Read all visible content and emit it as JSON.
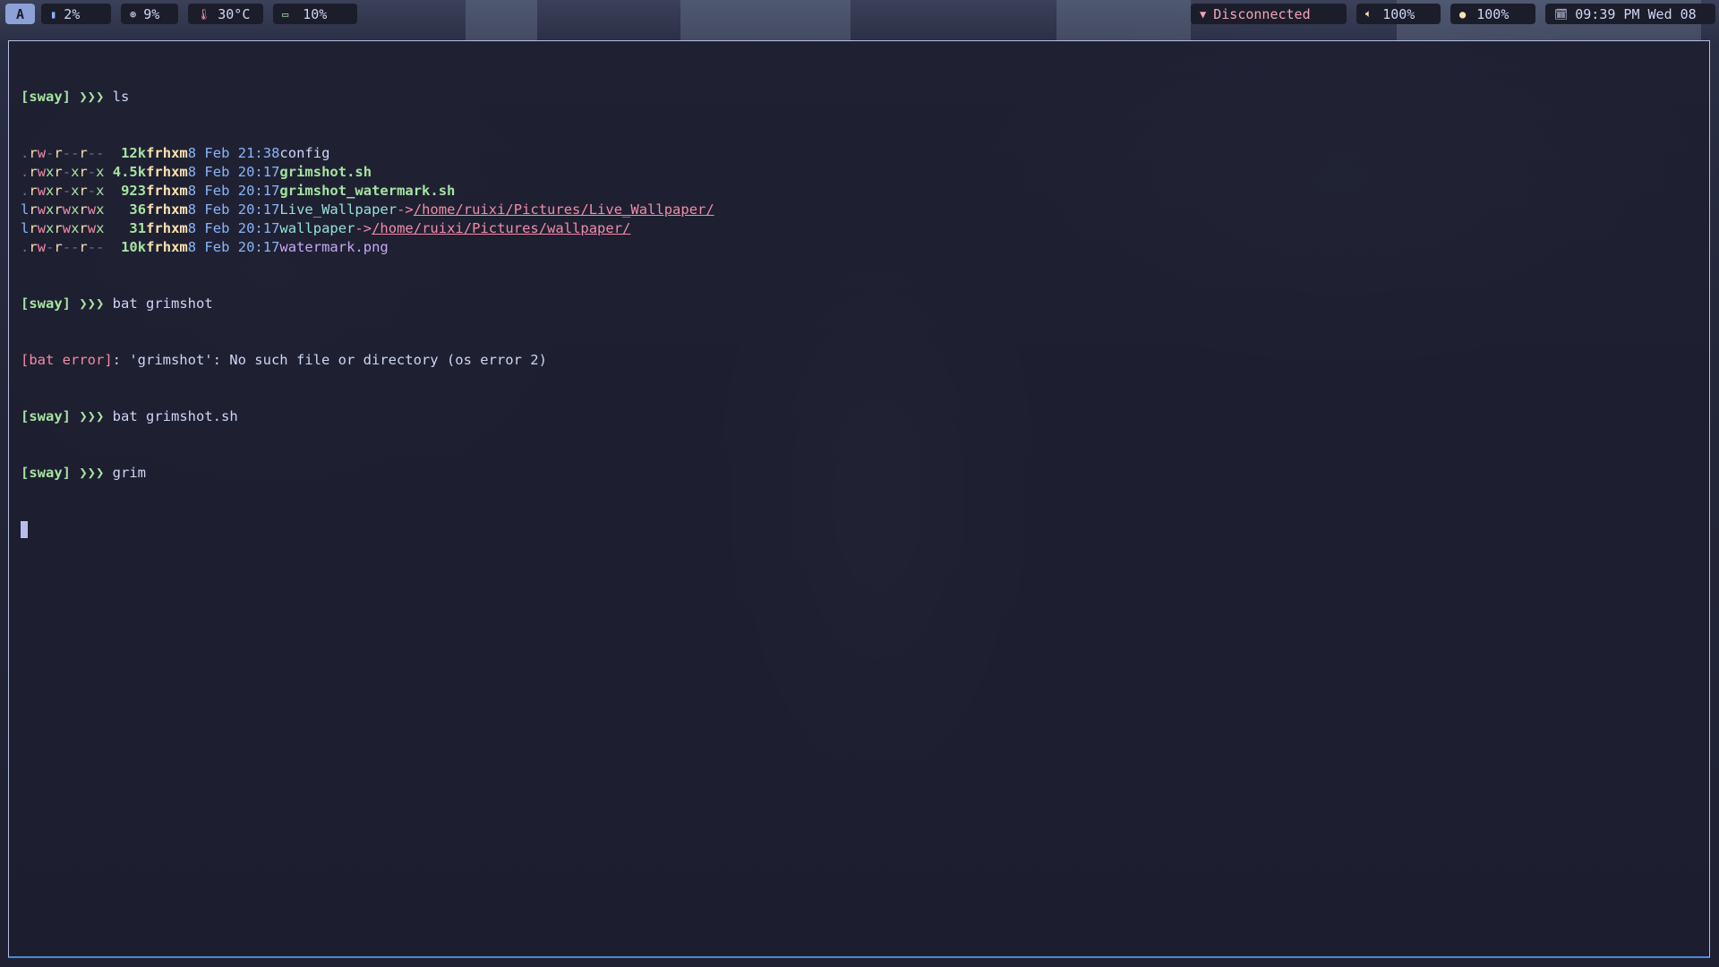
{
  "bar": {
    "workspace_label": "A",
    "memory": "2%",
    "cpu": "9%",
    "temperature": "30°C",
    "battery": "10%",
    "network": "Disconnected",
    "volume": "100%",
    "brightness": "100%",
    "datetime": "09:39 PM Wed 08",
    "icons": {
      "memory": "memory-icon",
      "cpu": "cpu-icon",
      "temperature": "thermometer-icon",
      "battery": "battery-icon",
      "network": "wifi-icon",
      "volume": "speaker-icon",
      "brightness": "brightness-icon",
      "clock": "calendar-icon"
    }
  },
  "terminal": {
    "prompt": "[sway] ❯❯❯",
    "commands": [
      "ls",
      "bat grimshot",
      "bat grimshot.sh",
      "grim"
    ],
    "ls_rows": [
      {
        "perm": ".rw-r--r--",
        "size": "12k",
        "user": "frhxm",
        "date": "8 Feb 21:38",
        "name": "config",
        "kind": "file",
        "target": ""
      },
      {
        "perm": ".rwxr-xr-x",
        "size": "4.5k",
        "user": "frhxm",
        "date": "8 Feb 20:17",
        "name": "grimshot.sh",
        "kind": "exec",
        "target": ""
      },
      {
        "perm": ".rwxr-xr-x",
        "size": "923",
        "user": "frhxm",
        "date": "8 Feb 20:17",
        "name": "grimshot_watermark.sh",
        "kind": "exec",
        "target": ""
      },
      {
        "perm": "lrwxrwxrwx",
        "size": "36",
        "user": "frhxm",
        "date": "8 Feb 20:17",
        "name": "Live_Wallpaper",
        "kind": "link",
        "target": "/home/ruixi/Pictures/Live_Wallpaper/"
      },
      {
        "perm": "lrwxrwxrwx",
        "size": "31",
        "user": "frhxm",
        "date": "8 Feb 20:17",
        "name": "wallpaper",
        "kind": "link",
        "target": "/home/ruixi/Pictures/wallpaper/"
      },
      {
        "perm": ".rw-r--r--",
        "size": "10k",
        "user": "frhxm",
        "date": "8 Feb 20:17",
        "name": "watermark.png",
        "kind": "image",
        "target": ""
      }
    ],
    "link_arrow": "->",
    "error_tag": "[bat error]",
    "error_message": ": 'grimshot': No such file or directory (os error 2)"
  },
  "colors": {
    "background": "#1e2031",
    "accent": "#8da1d8",
    "focus_border": "#4a8ad8",
    "prompt": "#a6e3a1",
    "error": "#f38ba8"
  }
}
